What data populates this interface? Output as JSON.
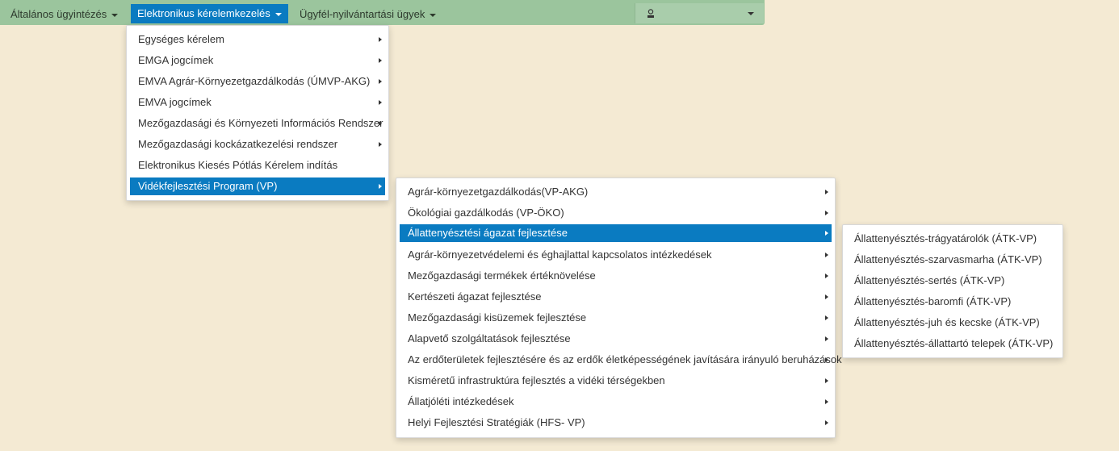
{
  "navbar": {
    "items": [
      {
        "label": "Általános ügyintézés"
      },
      {
        "label": "Elektronikus kérelemkezelés"
      },
      {
        "label": "Ügyfél-nyilvántartási ügyek"
      }
    ],
    "user_icon": "user-icon"
  },
  "menu1": {
    "items": [
      {
        "label": "Egységes kérelem",
        "has_submenu": true
      },
      {
        "label": "EMGA jogcímek",
        "has_submenu": true
      },
      {
        "label": "EMVA Agrár-Környezetgazdálkodás (ÚMVP-AKG)",
        "has_submenu": true
      },
      {
        "label": "EMVA jogcímek",
        "has_submenu": true
      },
      {
        "label": "Mezőgazdasági és Környezeti Információs Rendszer",
        "has_submenu": true
      },
      {
        "label": "Mezőgazdasági kockázatkezelési rendszer",
        "has_submenu": true
      },
      {
        "label": "Elektronikus Kiesés Pótlás Kérelem indítás",
        "has_submenu": false
      },
      {
        "label": "Vidékfejlesztési Program (VP)",
        "has_submenu": true
      }
    ]
  },
  "menu2": {
    "items": [
      {
        "label": "Agrár-környezetgazdálkodás(VP-AKG)"
      },
      {
        "label": "Ökológiai gazdálkodás (VP-ÖKO)"
      },
      {
        "label": "Állattenyésztési ágazat fejlesztése"
      },
      {
        "label": "Agrár-környezetvédelemi és éghajlattal kapcsolatos intézkedések"
      },
      {
        "label": "Mezőgazdasági termékek értéknövelése"
      },
      {
        "label": "Kertészeti ágazat fejlesztése"
      },
      {
        "label": "Mezőgazdasági kisüzemek fejlesztése"
      },
      {
        "label": "Alapvető szolgáltatások fejlesztése"
      },
      {
        "label": "Az erdőterületek fejlesztésére és az erdők életképességének javítására irányuló beruházások"
      },
      {
        "label": "Kisméretű infrastruktúra fejlesztés a vidéki térségekben"
      },
      {
        "label": "Állatjóléti intézkedések"
      },
      {
        "label": "Helyi Fejlesztési Stratégiák (HFS- VP)"
      }
    ]
  },
  "menu3": {
    "items": [
      {
        "label": "Állattenyésztés-trágyatárolók (ÁTK-VP)"
      },
      {
        "label": "Állattenyésztés-szarvasmarha (ÁTK-VP)"
      },
      {
        "label": "Állattenyésztés-sertés (ÁTK-VP)"
      },
      {
        "label": "Állattenyésztés-baromfi (ÁTK-VP)"
      },
      {
        "label": "Állattenyésztés-juh és kecske (ÁTK-VP)"
      },
      {
        "label": "Állattenyésztés-állattartó telepek (ÁTK-VP)"
      }
    ]
  },
  "colors": {
    "accent": "#0a7bc1",
    "navbar": "#9bc59d",
    "background": "#f4ead3"
  }
}
